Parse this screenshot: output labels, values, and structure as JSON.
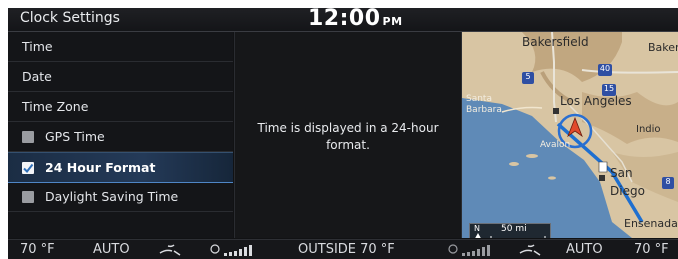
{
  "header": {
    "title": "Clock Settings",
    "time": "12:00",
    "ampm": "PM"
  },
  "menu": {
    "items": [
      {
        "label": "Time"
      },
      {
        "label": "Date"
      },
      {
        "label": "Time Zone"
      },
      {
        "label": "GPS Time",
        "checked": false
      },
      {
        "label": "24 Hour Format",
        "checked": true,
        "selected": true
      },
      {
        "label": "Daylight Saving Time",
        "checked": false
      }
    ]
  },
  "info": {
    "text": "Time is displayed in a 24-hour format."
  },
  "map": {
    "labels": {
      "bakersfield": "Bakersfield",
      "baker": "Baker",
      "los_angeles": "Los Angeles",
      "santa_barbara": "Santa Barbara",
      "indio": "Indio",
      "avalon": "Avalon",
      "san_diego": "San Diego",
      "ensenada": "Ensenada"
    },
    "shields": {
      "i5": "5",
      "i40": "40",
      "i15": "15",
      "i8": "8"
    },
    "compass": "N",
    "scale": "50 mi"
  },
  "climate": {
    "left_temp": "70 °F",
    "left_mode": "AUTO",
    "outside": "OUTSIDE  70 °F",
    "right_mode": "AUTO",
    "right_temp": "70 °F"
  },
  "colors": {
    "accent": "#4f86c6",
    "background": "#111214",
    "map_ocean": "#5f8ab7",
    "map_land": "#d9c7a7"
  }
}
